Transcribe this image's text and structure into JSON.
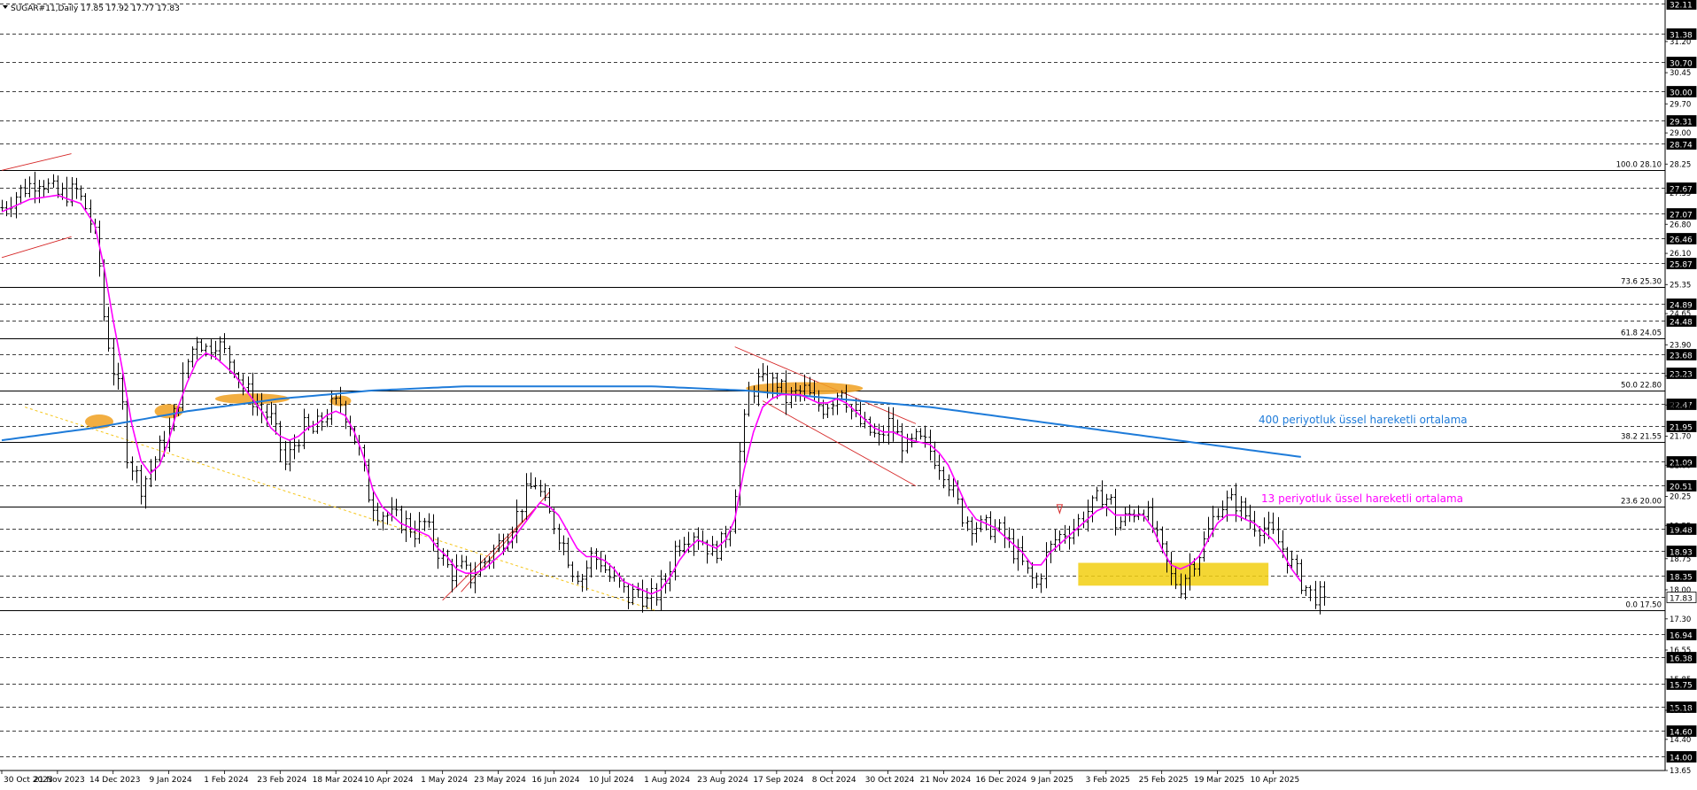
{
  "header": {
    "symbol_label": "SUGAR#11,Daily  17.85 17.92 17.77 17.83"
  },
  "colors": {
    "candle": "#000000",
    "grid": "#000000",
    "ema13": "#ff00ff",
    "ema400": "#1e7bd9",
    "channel": "#d62828",
    "fib_trend": "#f5c518",
    "highlight_orange": "#f0a020",
    "zone_yellow": "#f2cf10",
    "price_box": "#000000"
  },
  "chart_data": {
    "type": "line",
    "title": "SUGAR#11,Daily  17.85 17.92 17.77 17.83",
    "ylim": [
      13.65,
      32.2
    ],
    "grid": "horizontal dashed",
    "ohlc_last": {
      "open": 17.85,
      "high": 17.92,
      "low": 17.77,
      "close": 17.83
    },
    "x_tick_labels": [
      "30 Oct 2023",
      "21 Nov 2023",
      "14 Dec 2023",
      "9 Jan 2024",
      "1 Feb 2024",
      "23 Feb 2024",
      "18 Mar 2024",
      "10 Apr 2024",
      "1 May 2024",
      "23 May 2024",
      "16 Jun 2024",
      "10 Jul 2024",
      "1 Aug 2024",
      "23 Aug 2024",
      "17 Sep 2024",
      "8 Oct 2024",
      "30 Oct 2024",
      "21 Nov 2024",
      "16 Dec 2024",
      "9 Jan 2025",
      "3 Feb 2025",
      "25 Feb 2025",
      "19 Mar 2025",
      "10 Apr 2025"
    ],
    "boxed_price_levels": [
      32.11,
      31.38,
      30.7,
      30.0,
      29.31,
      28.74,
      27.67,
      27.07,
      26.46,
      25.87,
      24.89,
      24.48,
      23.68,
      23.23,
      22.47,
      21.95,
      21.09,
      20.51,
      19.48,
      18.93,
      18.35,
      17.83,
      16.94,
      16.38,
      15.75,
      15.18,
      14.6,
      14.0
    ],
    "plain_price_levels": [
      "31.20",
      "30.45",
      "29.70",
      "29.00",
      "28.25",
      "27.55",
      "26.80",
      "26.10",
      "25.35",
      "24.65",
      "23.90",
      "23.15",
      "22.45",
      "21.70",
      "21.00",
      "20.25",
      "19.55",
      "18.75",
      "18.00",
      "17.30",
      "16.55",
      "15.85",
      "15.10",
      "14.40",
      "13.65"
    ],
    "fibonacci_levels": [
      {
        "label": "100.0 28.10",
        "price": 28.1
      },
      {
        "label": "73.6 25.30",
        "price": 25.3
      },
      {
        "label": "61.8 24.05",
        "price": 24.05
      },
      {
        "label": "50.0 22.80",
        "price": 22.8
      },
      {
        "label": "38.2 21.55",
        "price": 21.55
      },
      {
        "label": "23.6 20.00",
        "price": 20.0
      },
      {
        "label": "0.0 17.50",
        "price": 17.5
      }
    ],
    "annotations": {
      "ema400": "400 periyotluk üssel hareketli ortalama",
      "ema13": "13 periyotluk üssel hareketli ortalama"
    },
    "price_series": [
      [
        0,
        27.2
      ],
      [
        4,
        27.6
      ],
      [
        8,
        27.9
      ],
      [
        12,
        27.5
      ],
      [
        16,
        27.6
      ],
      [
        18,
        27.2
      ],
      [
        20,
        26.5
      ],
      [
        21,
        25.8
      ],
      [
        22,
        24.6
      ],
      [
        24,
        23.3
      ],
      [
        26,
        22.4
      ],
      [
        27,
        21.3
      ],
      [
        28,
        21.0
      ],
      [
        30,
        20.5
      ],
      [
        32,
        20.9
      ],
      [
        34,
        21.4
      ],
      [
        36,
        21.8
      ],
      [
        38,
        22.6
      ],
      [
        40,
        23.5
      ],
      [
        42,
        24.1
      ],
      [
        44,
        23.8
      ],
      [
        46,
        24.0
      ],
      [
        48,
        23.7
      ],
      [
        50,
        23.4
      ],
      [
        52,
        22.9
      ],
      [
        54,
        22.6
      ],
      [
        56,
        22.3
      ],
      [
        58,
        22.1
      ],
      [
        60,
        21.4
      ],
      [
        61,
        21.0
      ],
      [
        63,
        21.5
      ],
      [
        65,
        21.9
      ],
      [
        67,
        21.8
      ],
      [
        69,
        22.1
      ],
      [
        71,
        22.4
      ],
      [
        73,
        22.5
      ],
      [
        75,
        22.0
      ],
      [
        77,
        21.3
      ],
      [
        79,
        20.3
      ],
      [
        81,
        19.9
      ],
      [
        83,
        19.8
      ],
      [
        85,
        19.7
      ],
      [
        87,
        19.6
      ],
      [
        89,
        19.4
      ],
      [
        91,
        19.6
      ],
      [
        93,
        19.2
      ],
      [
        95,
        18.7
      ],
      [
        97,
        18.4
      ],
      [
        99,
        18.5
      ],
      [
        101,
        18.3
      ],
      [
        103,
        18.6
      ],
      [
        105,
        18.8
      ],
      [
        107,
        19.1
      ],
      [
        109,
        19.4
      ],
      [
        111,
        19.8
      ],
      [
        113,
        20.3
      ],
      [
        115,
        20.6
      ],
      [
        117,
        20.0
      ],
      [
        119,
        19.6
      ],
      [
        121,
        19.1
      ],
      [
        123,
        18.5
      ],
      [
        125,
        18.3
      ],
      [
        127,
        18.8
      ],
      [
        129,
        18.7
      ],
      [
        131,
        18.3
      ],
      [
        133,
        18.1
      ],
      [
        135,
        17.8
      ],
      [
        137,
        18.0
      ],
      [
        139,
        17.7
      ],
      [
        141,
        17.9
      ],
      [
        143,
        18.2
      ],
      [
        145,
        19.0
      ],
      [
        147,
        19.3
      ],
      [
        149,
        19.4
      ],
      [
        151,
        19.2
      ],
      [
        153,
        18.9
      ],
      [
        155,
        19.1
      ],
      [
        157,
        19.6
      ],
      [
        159,
        21.3
      ],
      [
        161,
        22.7
      ],
      [
        163,
        23.0
      ],
      [
        165,
        22.9
      ],
      [
        167,
        23.0
      ],
      [
        169,
        22.6
      ],
      [
        171,
        22.7
      ],
      [
        173,
        22.8
      ],
      [
        175,
        22.5
      ],
      [
        177,
        22.4
      ],
      [
        179,
        22.6
      ],
      [
        181,
        22.9
      ],
      [
        183,
        22.3
      ],
      [
        185,
        22.0
      ],
      [
        187,
        21.8
      ],
      [
        189,
        21.6
      ],
      [
        191,
        22.0
      ],
      [
        193,
        21.7
      ],
      [
        195,
        21.4
      ],
      [
        197,
        21.6
      ],
      [
        199,
        21.5
      ],
      [
        201,
        21.2
      ],
      [
        203,
        20.9
      ],
      [
        205,
        20.3
      ],
      [
        207,
        19.8
      ],
      [
        209,
        19.6
      ],
      [
        211,
        19.5
      ],
      [
        213,
        19.5
      ],
      [
        215,
        19.4
      ],
      [
        217,
        19.1
      ],
      [
        219,
        18.8
      ],
      [
        221,
        18.4
      ],
      [
        223,
        18.1
      ],
      [
        225,
        18.8
      ],
      [
        227,
        19.2
      ],
      [
        229,
        19.4
      ],
      [
        231,
        19.5
      ],
      [
        233,
        19.8
      ],
      [
        235,
        20.0
      ],
      [
        237,
        20.3
      ],
      [
        239,
        20.1
      ],
      [
        240,
        19.6
      ],
      [
        242,
        19.7
      ],
      [
        244,
        19.9
      ],
      [
        246,
        20.0
      ],
      [
        248,
        19.5
      ],
      [
        250,
        18.9
      ],
      [
        252,
        18.3
      ],
      [
        254,
        18.1
      ],
      [
        256,
        18.6
      ],
      [
        258,
        18.9
      ],
      [
        260,
        19.4
      ],
      [
        262,
        20.0
      ],
      [
        264,
        20.1
      ],
      [
        266,
        20.1
      ],
      [
        268,
        19.8
      ],
      [
        270,
        19.6
      ],
      [
        272,
        19.5
      ],
      [
        274,
        19.3
      ],
      [
        276,
        19.0
      ],
      [
        278,
        18.6
      ],
      [
        280,
        18.2
      ],
      [
        282,
        17.9
      ],
      [
        284,
        17.83
      ]
    ],
    "ema13_series": [
      [
        0,
        27.1
      ],
      [
        6,
        27.4
      ],
      [
        12,
        27.5
      ],
      [
        17,
        27.3
      ],
      [
        20,
        26.8
      ],
      [
        22,
        25.8
      ],
      [
        24,
        24.5
      ],
      [
        26,
        23.3
      ],
      [
        28,
        22.0
      ],
      [
        30,
        21.1
      ],
      [
        32,
        20.8
      ],
      [
        34,
        21.0
      ],
      [
        36,
        21.6
      ],
      [
        38,
        22.4
      ],
      [
        40,
        23.0
      ],
      [
        42,
        23.5
      ],
      [
        44,
        23.7
      ],
      [
        46,
        23.6
      ],
      [
        48,
        23.4
      ],
      [
        50,
        23.2
      ],
      [
        52,
        22.9
      ],
      [
        54,
        22.6
      ],
      [
        56,
        22.3
      ],
      [
        58,
        21.9
      ],
      [
        60,
        21.7
      ],
      [
        62,
        21.6
      ],
      [
        64,
        21.7
      ],
      [
        66,
        21.9
      ],
      [
        68,
        22.0
      ],
      [
        70,
        22.2
      ],
      [
        72,
        22.3
      ],
      [
        74,
        22.2
      ],
      [
        76,
        21.8
      ],
      [
        78,
        21.2
      ],
      [
        80,
        20.4
      ],
      [
        82,
        20.0
      ],
      [
        84,
        19.8
      ],
      [
        86,
        19.6
      ],
      [
        88,
        19.5
      ],
      [
        90,
        19.4
      ],
      [
        92,
        19.3
      ],
      [
        94,
        19.0
      ],
      [
        96,
        18.8
      ],
      [
        98,
        18.5
      ],
      [
        100,
        18.4
      ],
      [
        102,
        18.4
      ],
      [
        104,
        18.5
      ],
      [
        106,
        18.7
      ],
      [
        108,
        18.9
      ],
      [
        110,
        19.2
      ],
      [
        112,
        19.5
      ],
      [
        114,
        19.8
      ],
      [
        116,
        20.1
      ],
      [
        118,
        20.0
      ],
      [
        120,
        19.8
      ],
      [
        122,
        19.4
      ],
      [
        124,
        19.0
      ],
      [
        126,
        18.8
      ],
      [
        128,
        18.8
      ],
      [
        130,
        18.7
      ],
      [
        132,
        18.5
      ],
      [
        134,
        18.2
      ],
      [
        136,
        18.1
      ],
      [
        138,
        18.0
      ],
      [
        140,
        17.9
      ],
      [
        142,
        18.0
      ],
      [
        144,
        18.3
      ],
      [
        146,
        18.7
      ],
      [
        148,
        19.0
      ],
      [
        150,
        19.2
      ],
      [
        152,
        19.1
      ],
      [
        154,
        19.0
      ],
      [
        156,
        19.2
      ],
      [
        158,
        19.7
      ],
      [
        160,
        20.9
      ],
      [
        162,
        21.8
      ],
      [
        164,
        22.4
      ],
      [
        166,
        22.6
      ],
      [
        168,
        22.7
      ],
      [
        170,
        22.7
      ],
      [
        172,
        22.7
      ],
      [
        174,
        22.6
      ],
      [
        176,
        22.5
      ],
      [
        178,
        22.5
      ],
      [
        180,
        22.6
      ],
      [
        182,
        22.5
      ],
      [
        184,
        22.3
      ],
      [
        186,
        22.1
      ],
      [
        188,
        21.9
      ],
      [
        190,
        21.8
      ],
      [
        192,
        21.8
      ],
      [
        194,
        21.7
      ],
      [
        196,
        21.6
      ],
      [
        198,
        21.55
      ],
      [
        200,
        21.5
      ],
      [
        202,
        21.3
      ],
      [
        204,
        21.0
      ],
      [
        206,
        20.5
      ],
      [
        208,
        20.0
      ],
      [
        210,
        19.7
      ],
      [
        212,
        19.6
      ],
      [
        214,
        19.5
      ],
      [
        216,
        19.3
      ],
      [
        218,
        19.1
      ],
      [
        220,
        18.9
      ],
      [
        222,
        18.6
      ],
      [
        224,
        18.6
      ],
      [
        226,
        18.9
      ],
      [
        228,
        19.1
      ],
      [
        230,
        19.3
      ],
      [
        232,
        19.5
      ],
      [
        234,
        19.7
      ],
      [
        236,
        19.9
      ],
      [
        238,
        20.0
      ],
      [
        240,
        19.8
      ],
      [
        242,
        19.8
      ],
      [
        244,
        19.8
      ],
      [
        246,
        19.8
      ],
      [
        248,
        19.5
      ],
      [
        250,
        19.0
      ],
      [
        252,
        18.6
      ],
      [
        254,
        18.5
      ],
      [
        256,
        18.6
      ],
      [
        258,
        18.8
      ],
      [
        260,
        19.2
      ],
      [
        262,
        19.6
      ],
      [
        264,
        19.8
      ],
      [
        266,
        19.8
      ],
      [
        268,
        19.7
      ],
      [
        270,
        19.6
      ],
      [
        272,
        19.4
      ],
      [
        274,
        19.2
      ],
      [
        276,
        18.9
      ],
      [
        278,
        18.5
      ],
      [
        280,
        18.2
      ]
    ],
    "ema400_series": [
      [
        0,
        21.6
      ],
      [
        20,
        21.9
      ],
      [
        40,
        22.3
      ],
      [
        60,
        22.6
      ],
      [
        80,
        22.8
      ],
      [
        100,
        22.9
      ],
      [
        120,
        22.9
      ],
      [
        140,
        22.9
      ],
      [
        160,
        22.8
      ],
      [
        180,
        22.6
      ],
      [
        200,
        22.4
      ],
      [
        220,
        22.1
      ],
      [
        240,
        21.8
      ],
      [
        260,
        21.5
      ],
      [
        280,
        21.2
      ]
    ]
  }
}
